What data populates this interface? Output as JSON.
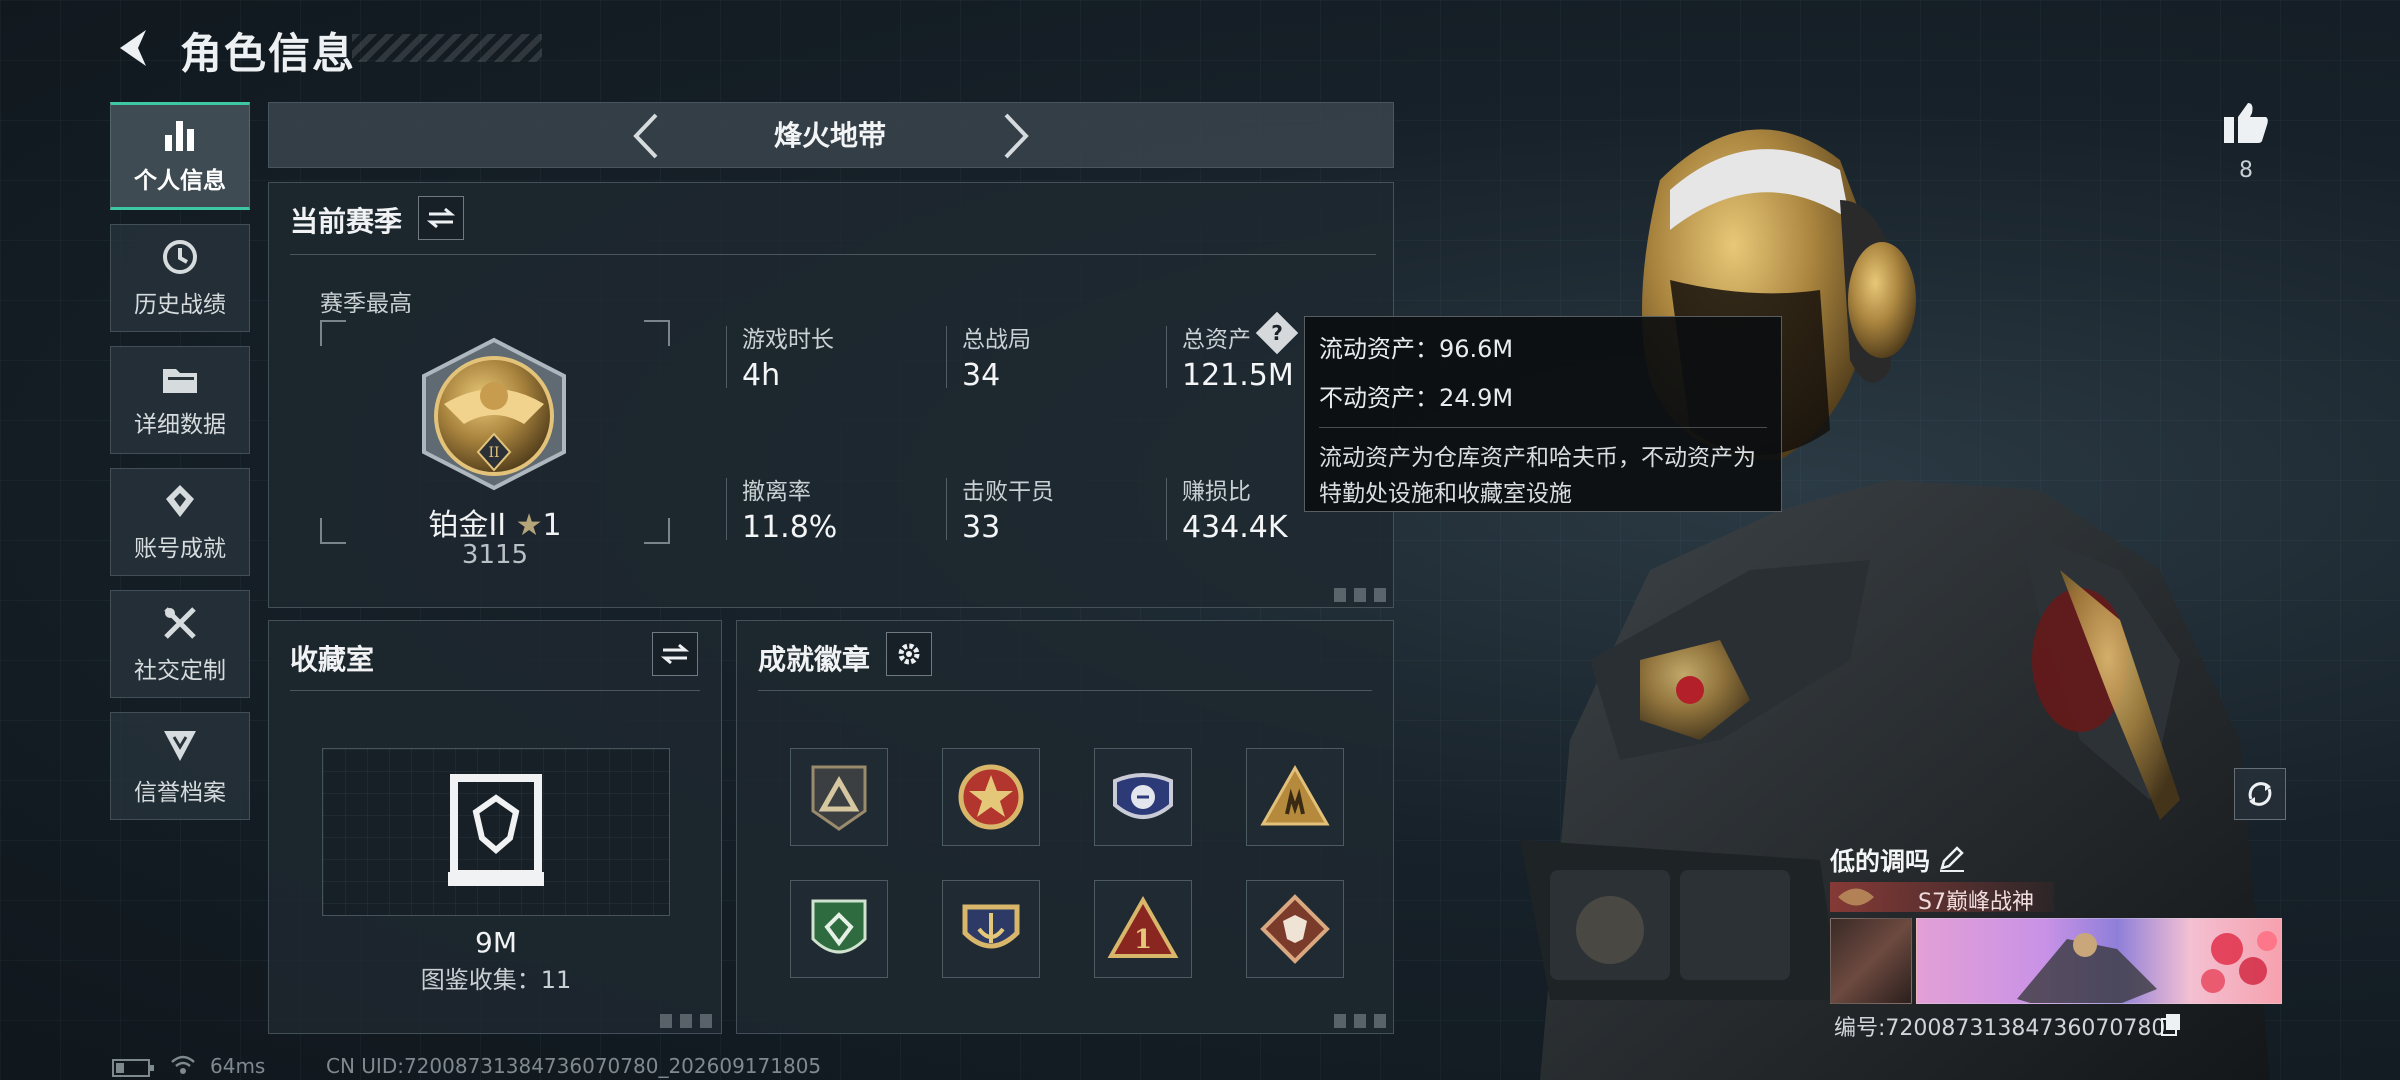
{
  "header": {
    "title": "角色信息"
  },
  "nav": {
    "items": [
      {
        "label": "个人信息",
        "icon": "bar-chart-icon",
        "active": true
      },
      {
        "label": "历史战绩",
        "icon": "history-icon",
        "active": false
      },
      {
        "label": "详细数据",
        "icon": "folder-icon",
        "active": false
      },
      {
        "label": "账号成就",
        "icon": "achievement-icon",
        "active": false
      },
      {
        "label": "社交定制",
        "icon": "tools-icon",
        "active": false
      },
      {
        "label": "信誉档案",
        "icon": "shield-icon",
        "active": false
      }
    ]
  },
  "mode": {
    "title": "烽火地带"
  },
  "season": {
    "title": "当前赛季",
    "best_label": "赛季最高",
    "rank_name": "铂金II",
    "rank_stars": "1",
    "rank_score": "3115",
    "stats": [
      {
        "label": "游戏时长",
        "value": "4h"
      },
      {
        "label": "总战局",
        "value": "34"
      },
      {
        "label": "总资产",
        "value": "121.5M"
      },
      {
        "label": "撤离率",
        "value": "11.8%"
      },
      {
        "label": "击败干员",
        "value": "33"
      },
      {
        "label": "赚损比",
        "value": "434.4K"
      }
    ]
  },
  "tooltip": {
    "liquid": "流动资产：96.6M",
    "fixed": "不动资产：24.9M",
    "desc": "流动资产为仓库资产和哈夫币，不动资产为特勤处设施和收藏室设施"
  },
  "collection": {
    "title": "收藏室",
    "value": "9M",
    "count": "图鉴收集：11"
  },
  "badges": {
    "title": "成就徽章",
    "items": [
      "triangle-badge-icon",
      "star-medal-icon",
      "wing-shield-icon",
      "soldiers-triangle-icon",
      "green-shield-icon",
      "anchor-crest-icon",
      "number-one-triangle-icon",
      "wolf-diamond-icon"
    ]
  },
  "profile": {
    "likes": "8",
    "name": "低的调吗",
    "title": "S7巅峰战神",
    "uid_line": "编号:72008731384736070780"
  },
  "footer": {
    "ping": "64ms",
    "uid": "CN UID:72008731384736070780_202609171805"
  },
  "colors": {
    "accent": "#3ec7a4",
    "tooltip_bg": "#0c0e10",
    "panel_bg": "#1e282f"
  }
}
